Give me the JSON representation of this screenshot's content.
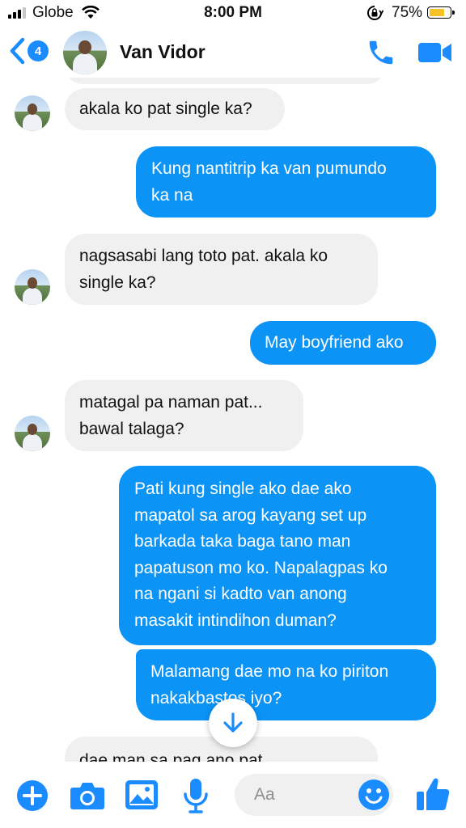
{
  "status_bar": {
    "carrier": "Globe",
    "time": "8:00 PM",
    "battery_percent": "75%",
    "battery_level": 0.75,
    "signal_bars_filled": 3,
    "signal_bars_total": 4
  },
  "header": {
    "back_badge_count": "4",
    "contact_name": "Van Vidor",
    "icons": [
      "chevron-left-icon",
      "phone-icon",
      "video-camera-icon"
    ]
  },
  "messages": [
    {
      "direction": "incoming",
      "lines": [
        "akala ko pat single ka?"
      ]
    },
    {
      "direction": "outgoing",
      "lines": [
        "Kung nantitrip ka van pumundo",
        "ka na"
      ]
    },
    {
      "direction": "incoming",
      "lines": [
        "nagsasabi lang toto pat. akala ko",
        "single ka?"
      ]
    },
    {
      "direction": "outgoing",
      "lines": [
        "May boyfriend ako"
      ]
    },
    {
      "direction": "incoming",
      "lines": [
        "matagal pa naman pat...",
        "bawal talaga?"
      ]
    },
    {
      "direction": "outgoing",
      "lines": [
        "Pati kung single ako dae ako",
        "mapatol sa arog kayang set up",
        "barkada taka baga tano man",
        "papatuson mo ko. Napalagpas ko",
        "na ngani si kadto van anong",
        "masakit intindihon duman?"
      ]
    },
    {
      "direction": "outgoing",
      "lines": [
        "Malamang dae mo na ko piriton",
        "nakakbastos iyo?"
      ]
    },
    {
      "direction": "incoming",
      "lines": [
        "dae man sa pag ano pat..."
      ]
    }
  ],
  "composer": {
    "placeholder": "Aa",
    "icons": [
      "plus-icon",
      "camera-icon",
      "gallery-icon",
      "microphone-icon",
      "emoji-icon",
      "thumbs-up-icon"
    ]
  },
  "colors": {
    "accent": "#0b93f6",
    "icon_blue": "#1a8cff",
    "incoming_bubble": "#f1f0f0",
    "battery": "#f6c324"
  }
}
